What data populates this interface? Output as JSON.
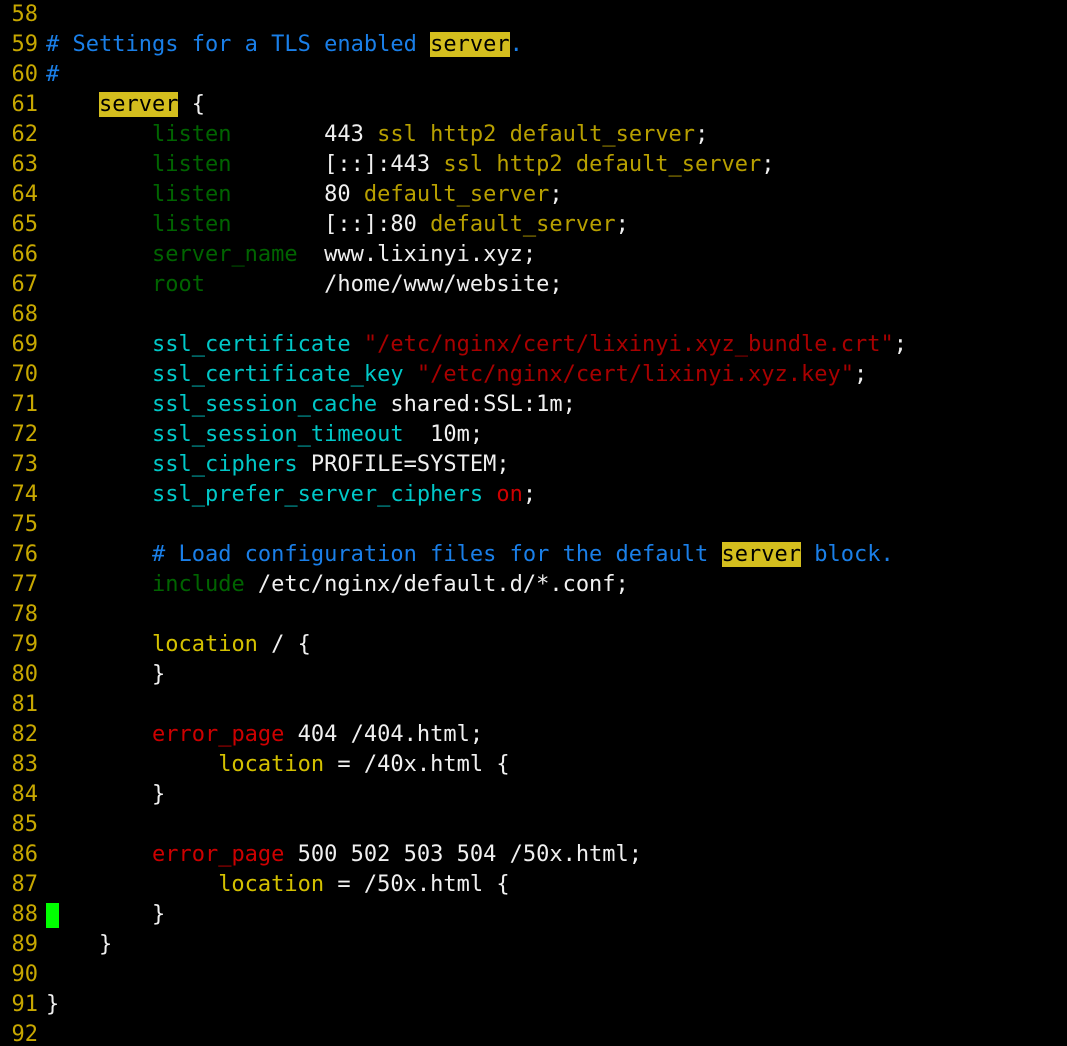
{
  "editor": {
    "kind": "terminal-text-editor",
    "filetype": "nginx-conf",
    "background_color": "#000000",
    "cursor": {
      "line": 88,
      "column": 1,
      "color": "#00ff00"
    },
    "highlight": {
      "term": "server",
      "background_color": "#d4be1e",
      "text_color": "#000000"
    },
    "colors": {
      "line_number": "#c8a800",
      "comment": "#1a7fe8",
      "directive": "#006400",
      "ssl_directive": "#00c8c8",
      "location_keyword": "#d4c100",
      "error_page_keyword": "#cc0000",
      "string": "#a80000",
      "value": "#b8a000",
      "plain": "#f0f0f0"
    }
  },
  "lines": [
    {
      "n": "58",
      "tokens": []
    },
    {
      "n": "59",
      "tokens": [
        {
          "t": "# Settings for a TLS enabled ",
          "c": "t-comment"
        },
        {
          "t": "server",
          "c": "hl"
        },
        {
          "t": ".",
          "c": "t-comment"
        }
      ]
    },
    {
      "n": "60",
      "tokens": [
        {
          "t": "#",
          "c": "t-comment"
        }
      ]
    },
    {
      "n": "61",
      "tokens": [
        {
          "t": "    ",
          "c": "t-plain"
        },
        {
          "t": "server",
          "c": "hl"
        },
        {
          "t": " {",
          "c": "t-brace"
        }
      ]
    },
    {
      "n": "62",
      "tokens": [
        {
          "t": "        ",
          "c": "t-plain"
        },
        {
          "t": "listen",
          "c": "t-directive"
        },
        {
          "t": "       ",
          "c": "t-plain"
        },
        {
          "t": "443",
          "c": "t-plain"
        },
        {
          "t": " ssl http2 default_server",
          "c": "t-value"
        },
        {
          "t": ";",
          "c": "t-plain"
        }
      ]
    },
    {
      "n": "63",
      "tokens": [
        {
          "t": "        ",
          "c": "t-plain"
        },
        {
          "t": "listen",
          "c": "t-directive"
        },
        {
          "t": "       ",
          "c": "t-plain"
        },
        {
          "t": "[::]:443",
          "c": "t-plain"
        },
        {
          "t": " ssl http2 default_server",
          "c": "t-value"
        },
        {
          "t": ";",
          "c": "t-plain"
        }
      ]
    },
    {
      "n": "64",
      "tokens": [
        {
          "t": "        ",
          "c": "t-plain"
        },
        {
          "t": "listen",
          "c": "t-directive"
        },
        {
          "t": "       ",
          "c": "t-plain"
        },
        {
          "t": "80",
          "c": "t-plain"
        },
        {
          "t": " default_server",
          "c": "t-value"
        },
        {
          "t": ";",
          "c": "t-plain"
        }
      ]
    },
    {
      "n": "65",
      "tokens": [
        {
          "t": "        ",
          "c": "t-plain"
        },
        {
          "t": "listen",
          "c": "t-directive"
        },
        {
          "t": "       ",
          "c": "t-plain"
        },
        {
          "t": "[::]:80",
          "c": "t-plain"
        },
        {
          "t": " default_server",
          "c": "t-value"
        },
        {
          "t": ";",
          "c": "t-plain"
        }
      ]
    },
    {
      "n": "66",
      "tokens": [
        {
          "t": "        ",
          "c": "t-plain"
        },
        {
          "t": "server_name",
          "c": "t-directive"
        },
        {
          "t": "  www.lixinyi.xyz;",
          "c": "t-plain"
        }
      ]
    },
    {
      "n": "67",
      "tokens": [
        {
          "t": "        ",
          "c": "t-plain"
        },
        {
          "t": "root",
          "c": "t-directive"
        },
        {
          "t": "         /home/www/website;",
          "c": "t-plain"
        }
      ]
    },
    {
      "n": "68",
      "tokens": []
    },
    {
      "n": "69",
      "tokens": [
        {
          "t": "        ",
          "c": "t-plain"
        },
        {
          "t": "ssl_certificate",
          "c": "t-ssl"
        },
        {
          "t": " ",
          "c": "t-plain"
        },
        {
          "t": "\"/etc/nginx/cert/lixinyi.xyz_bundle.crt\"",
          "c": "t-string"
        },
        {
          "t": ";",
          "c": "t-plain"
        }
      ]
    },
    {
      "n": "70",
      "tokens": [
        {
          "t": "        ",
          "c": "t-plain"
        },
        {
          "t": "ssl_certificate_key",
          "c": "t-ssl"
        },
        {
          "t": " ",
          "c": "t-plain"
        },
        {
          "t": "\"/etc/nginx/cert/lixinyi.xyz.key\"",
          "c": "t-string"
        },
        {
          "t": ";",
          "c": "t-plain"
        }
      ]
    },
    {
      "n": "71",
      "tokens": [
        {
          "t": "        ",
          "c": "t-plain"
        },
        {
          "t": "ssl_session_cache",
          "c": "t-ssl"
        },
        {
          "t": " shared:SSL:1m;",
          "c": "t-plain"
        }
      ]
    },
    {
      "n": "72",
      "tokens": [
        {
          "t": "        ",
          "c": "t-plain"
        },
        {
          "t": "ssl_session_timeout",
          "c": "t-ssl"
        },
        {
          "t": "  10m;",
          "c": "t-plain"
        }
      ]
    },
    {
      "n": "73",
      "tokens": [
        {
          "t": "        ",
          "c": "t-plain"
        },
        {
          "t": "ssl_ciphers",
          "c": "t-ssl"
        },
        {
          "t": " PROFILE=SYSTEM;",
          "c": "t-plain"
        }
      ]
    },
    {
      "n": "74",
      "tokens": [
        {
          "t": "        ",
          "c": "t-plain"
        },
        {
          "t": "ssl_prefer_server_ciphers",
          "c": "t-ssl"
        },
        {
          "t": " ",
          "c": "t-plain"
        },
        {
          "t": "on",
          "c": "t-on"
        },
        {
          "t": ";",
          "c": "t-plain"
        }
      ]
    },
    {
      "n": "75",
      "tokens": []
    },
    {
      "n": "76",
      "tokens": [
        {
          "t": "        ",
          "c": "t-plain"
        },
        {
          "t": "# Load configuration files for the default ",
          "c": "t-comment"
        },
        {
          "t": "server",
          "c": "hl"
        },
        {
          "t": " block.",
          "c": "t-comment"
        }
      ]
    },
    {
      "n": "77",
      "tokens": [
        {
          "t": "        ",
          "c": "t-plain"
        },
        {
          "t": "include",
          "c": "t-directive"
        },
        {
          "t": " /etc/nginx/default.d/*.conf;",
          "c": "t-plain"
        }
      ]
    },
    {
      "n": "78",
      "tokens": []
    },
    {
      "n": "79",
      "tokens": [
        {
          "t": "        ",
          "c": "t-plain"
        },
        {
          "t": "location",
          "c": "t-location"
        },
        {
          "t": " / {",
          "c": "t-plain"
        }
      ]
    },
    {
      "n": "80",
      "tokens": [
        {
          "t": "        }",
          "c": "t-brace"
        }
      ]
    },
    {
      "n": "81",
      "tokens": []
    },
    {
      "n": "82",
      "tokens": [
        {
          "t": "        ",
          "c": "t-plain"
        },
        {
          "t": "error_page",
          "c": "t-err"
        },
        {
          "t": " 404 /404.html;",
          "c": "t-plain"
        }
      ]
    },
    {
      "n": "83",
      "tokens": [
        {
          "t": "             ",
          "c": "t-plain"
        },
        {
          "t": "location",
          "c": "t-location"
        },
        {
          "t": " = /40x.html {",
          "c": "t-plain"
        }
      ]
    },
    {
      "n": "84",
      "tokens": [
        {
          "t": "        }",
          "c": "t-brace"
        }
      ]
    },
    {
      "n": "85",
      "tokens": []
    },
    {
      "n": "86",
      "tokens": [
        {
          "t": "        ",
          "c": "t-plain"
        },
        {
          "t": "error_page",
          "c": "t-err"
        },
        {
          "t": " 500 502 503 504 /50x.html;",
          "c": "t-plain"
        }
      ]
    },
    {
      "n": "87",
      "tokens": [
        {
          "t": "             ",
          "c": "t-plain"
        },
        {
          "t": "location",
          "c": "t-location"
        },
        {
          "t": " = /50x.html {",
          "c": "t-plain"
        }
      ]
    },
    {
      "n": "88",
      "tokens": [
        {
          "t": "        }",
          "c": "t-brace"
        }
      ],
      "cursor": true
    },
    {
      "n": "89",
      "tokens": [
        {
          "t": "    }",
          "c": "t-brace"
        }
      ]
    },
    {
      "n": "90",
      "tokens": []
    },
    {
      "n": "91",
      "tokens": [
        {
          "t": "}",
          "c": "t-brace"
        }
      ]
    },
    {
      "n": "92",
      "tokens": []
    }
  ]
}
